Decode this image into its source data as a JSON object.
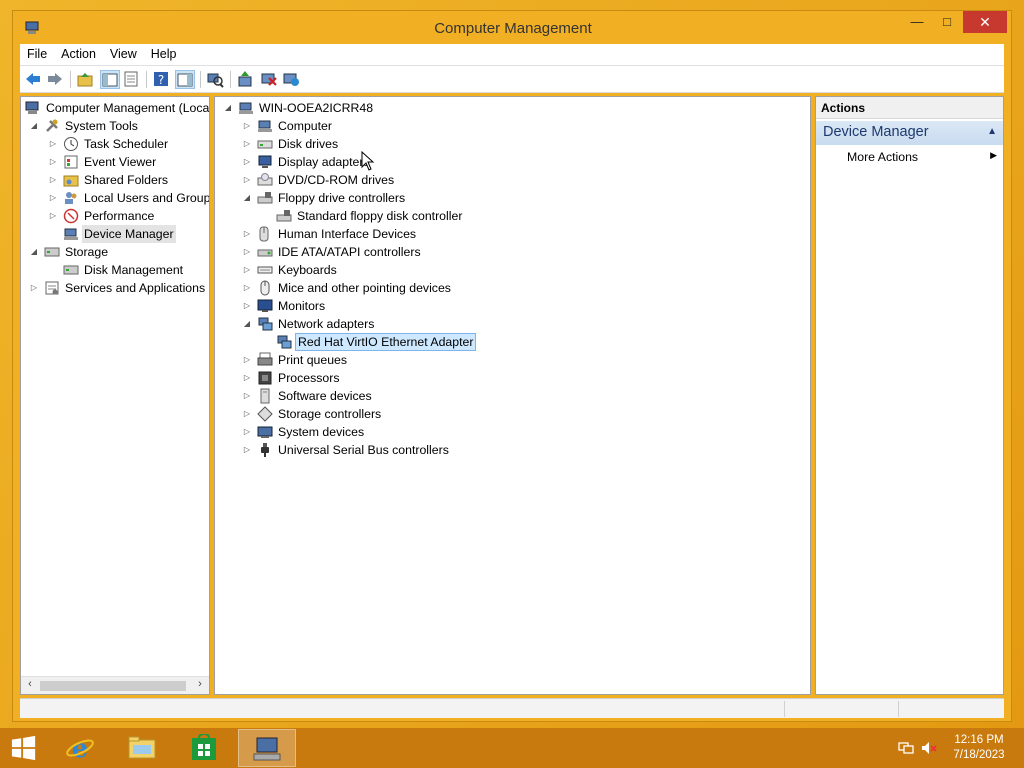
{
  "window": {
    "title": "Computer Management",
    "close_glyph": "✕",
    "max_glyph": "□",
    "min_glyph": "—"
  },
  "menu": [
    "File",
    "Action",
    "View",
    "Help"
  ],
  "left_tree": {
    "root": "Computer Management (Local",
    "items": [
      {
        "label": "System Tools",
        "expander": "◢"
      },
      {
        "label": "Task Scheduler",
        "expander": "▷"
      },
      {
        "label": "Event Viewer",
        "expander": "▷"
      },
      {
        "label": "Shared Folders",
        "expander": "▷"
      },
      {
        "label": "Local Users and Groups",
        "expander": "▷"
      },
      {
        "label": "Performance",
        "expander": "▷"
      },
      {
        "label": "Device Manager",
        "expander": ""
      },
      {
        "label": "Storage",
        "expander": "◢"
      },
      {
        "label": "Disk Management",
        "expander": ""
      },
      {
        "label": "Services and Applications",
        "expander": "▷"
      }
    ],
    "scroll_left": "‹",
    "scroll_right": "›"
  },
  "device_tree": {
    "root": "WIN-OOEA2ICRR48",
    "items": [
      {
        "label": "Computer",
        "expander": "▷"
      },
      {
        "label": "Disk drives",
        "expander": "▷"
      },
      {
        "label": "Display adapters",
        "expander": "▷"
      },
      {
        "label": "DVD/CD-ROM drives",
        "expander": "▷"
      },
      {
        "label": "Floppy drive controllers",
        "expander": "◢"
      },
      {
        "label": "Standard floppy disk controller",
        "expander": ""
      },
      {
        "label": "Human Interface Devices",
        "expander": "▷"
      },
      {
        "label": "IDE ATA/ATAPI controllers",
        "expander": "▷"
      },
      {
        "label": "Keyboards",
        "expander": "▷"
      },
      {
        "label": "Mice and other pointing devices",
        "expander": "▷"
      },
      {
        "label": "Monitors",
        "expander": "▷"
      },
      {
        "label": "Network adapters",
        "expander": "◢"
      },
      {
        "label": "Red Hat VirtIO Ethernet Adapter",
        "expander": ""
      },
      {
        "label": "Print queues",
        "expander": "▷"
      },
      {
        "label": "Processors",
        "expander": "▷"
      },
      {
        "label": "Software devices",
        "expander": "▷"
      },
      {
        "label": "Storage controllers",
        "expander": "▷"
      },
      {
        "label": "System devices",
        "expander": "▷"
      },
      {
        "label": "Universal Serial Bus controllers",
        "expander": "▷"
      }
    ]
  },
  "actions": {
    "header": "Actions",
    "section": "Device Manager",
    "collapse_glyph": "▲",
    "more_actions": "More Actions",
    "more_glyph": "▶"
  },
  "taskbar": {
    "time": "12:16 PM",
    "date": "7/18/2023"
  },
  "colors": {
    "accent": "#f1b024",
    "taskbar": "#c87a0e",
    "selection": "#cde8ff",
    "close": "#c7392e"
  }
}
